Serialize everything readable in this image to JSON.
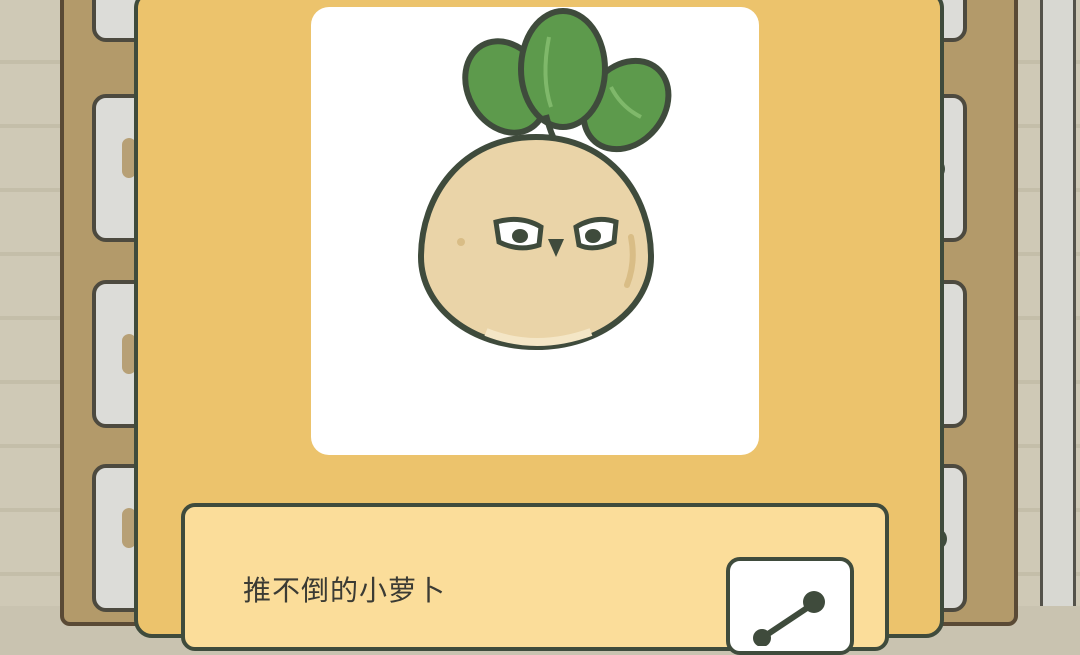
{
  "item": {
    "name": "推不倒的小萝卜",
    "icon": "radish-character"
  },
  "share": {
    "icon": "share-icon"
  },
  "colors": {
    "dialog_bg": "#ecc36c",
    "panel_bg": "#fbdd9a",
    "outline": "#3f4b3c",
    "leaf_green": "#5d9a4c",
    "radish_body": "#ead4a8"
  }
}
